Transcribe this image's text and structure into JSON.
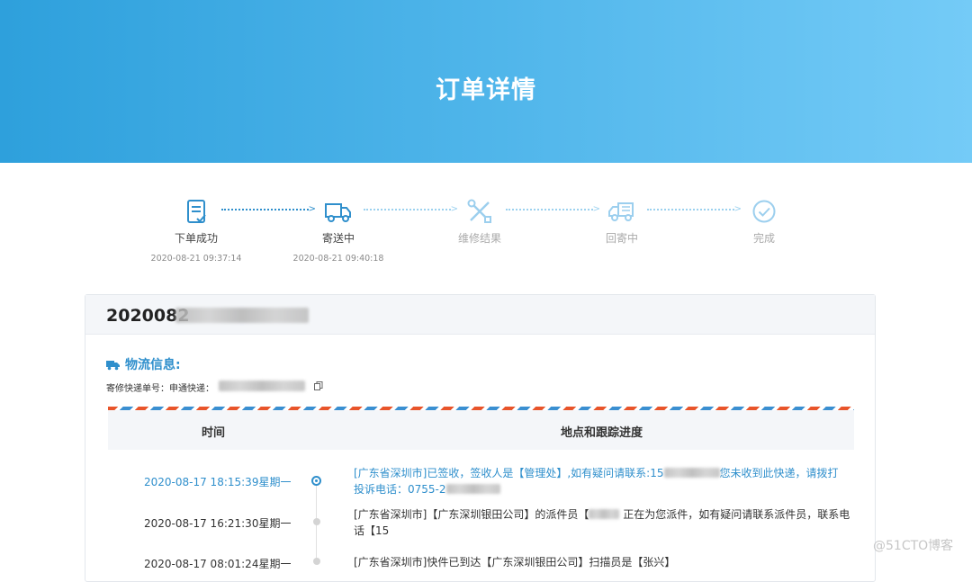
{
  "header": {
    "title": "订单详情"
  },
  "steps": [
    {
      "label": "下单成功",
      "time": "2020-08-21 09:37:14",
      "icon": "clipboard-check-icon",
      "active": true
    },
    {
      "label": "寄送中",
      "time": "2020-08-21 09:40:18",
      "icon": "truck-icon",
      "active": true
    },
    {
      "label": "维修结果",
      "time": "",
      "icon": "tools-icon",
      "active": false
    },
    {
      "label": "回寄中",
      "time": "",
      "icon": "fast-truck-icon",
      "active": false
    },
    {
      "label": "完成",
      "time": "",
      "icon": "check-circle-icon",
      "active": false
    }
  ],
  "order": {
    "number_visible": "2020082"
  },
  "logistics": {
    "title": "物流信息:",
    "tracking_label": "寄修快递单号：申通快递："
  },
  "table": {
    "col_time": "时间",
    "col_progress": "地点和跟踪进度",
    "rows": [
      {
        "time": "2020-08-17 18:15:39星期一",
        "line1": "[广东省深圳市]已签收，签收人是【管理处】,如有疑问请联系:15",
        "line1b": "您未收到此快递，请拨打",
        "line2": "投诉电话：0755-2",
        "active": true
      },
      {
        "time": "2020-08-17 16:21:30星期一",
        "line1": "[广东省深圳市]【广东深圳银田公司】的派件员【",
        "line1b": "正在为您派件，如有疑问请联系派件员，联系电",
        "line2": "话【15",
        "active": false
      },
      {
        "time": "2020-08-17 08:01:24星期一",
        "line1": "[广东省深圳市]快件已到达【广东深圳银田公司】扫描员是【张兴】",
        "line1b": "",
        "line2": "",
        "active": false
      }
    ]
  },
  "watermark": "@51CTO博客",
  "colors": {
    "primary": "#2f8fcc",
    "hero_start": "#2ea0dc",
    "hero_end": "#74cbf7"
  }
}
